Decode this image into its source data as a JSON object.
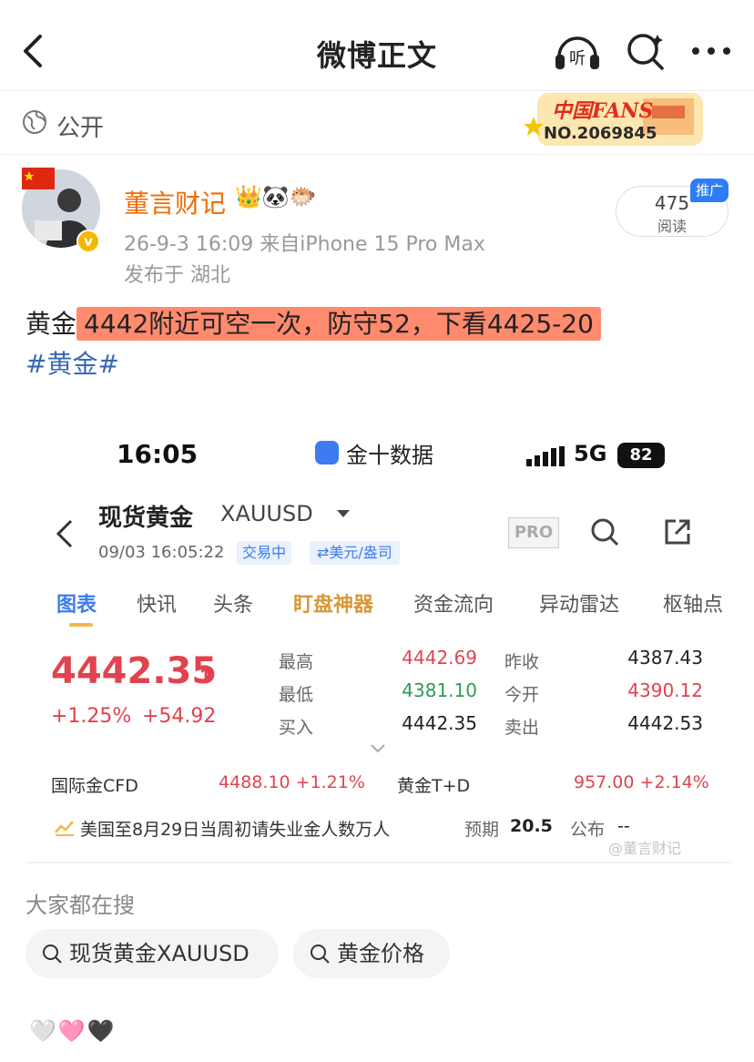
{
  "navbar": {
    "title": "微博正文",
    "listen_icon_text": "听"
  },
  "visibility": {
    "label": "公开"
  },
  "fans_badge": {
    "title": "中国FANS",
    "number": "NO.2069845"
  },
  "author": {
    "name": "董言财记",
    "badges": "👑🐼🐡",
    "verified_mark": "v",
    "post_meta": "26-9-3 16:09  来自iPhone 15 Pro Max",
    "location": "发布于 湖北"
  },
  "read_pill": {
    "count": "475",
    "label": "阅读",
    "promo_tag": "推广"
  },
  "post": {
    "prefix": "黄金",
    "highlight": "4442附近可空一次，防守52，下看4425-20",
    "hashtag": "#黄金#"
  },
  "screenshot": {
    "status_time": "16:05",
    "app_name": "金十数据",
    "network": "5G",
    "battery": "82",
    "title": "现货黄金",
    "symbol": "XAUUSD",
    "datetime": "09/03 16:05:22",
    "trade_status": "交易中",
    "unit": "⇄美元/盎司",
    "pro_label": "PRO",
    "tabs": [
      "图表",
      "快讯",
      "头条",
      "盯盘神器",
      "资金流向",
      "异动雷达",
      "枢轴点"
    ],
    "quote": {
      "price": "4442.35",
      "arrow": "↑",
      "change_pct": "+1.25%",
      "change": "+54.92",
      "high_label": "最高",
      "high": "4442.69",
      "low_label": "最低",
      "low": "4381.10",
      "bid_label": "买入",
      "bid": "4442.35",
      "prev_close_label": "昨收",
      "prev_close": "4387.43",
      "open_label": "今开",
      "open": "4390.12",
      "ask_label": "卖出",
      "ask": "4442.53"
    },
    "ext1": {
      "label": "国际金CFD",
      "value": "4488.10 +1.21%"
    },
    "ext2": {
      "label": "黄金T+D",
      "value": "957.00 +2.14%"
    },
    "news": {
      "text": "美国至8月29日当周初请失业金人数万人",
      "expect_label": "预期",
      "expect_value": "20.5",
      "publish_label": "公布",
      "publish_value": "--"
    },
    "watermark": "@董言财记"
  },
  "search_section": {
    "title": "大家都在搜",
    "chips": [
      "现货黄金XAUUSD",
      "黄金价格"
    ]
  },
  "footer_emojis": "🤍🩷🖤",
  "colors": {
    "author_name": "#f06c00",
    "highlight_bg": "#ff8a6e",
    "hashtag": "#3a68b8",
    "price_up": "#e0434e",
    "price_down": "#2e9b57",
    "tab_active": "#3c7cf0"
  }
}
